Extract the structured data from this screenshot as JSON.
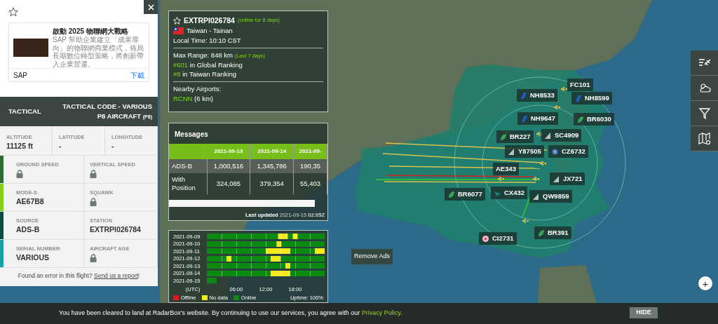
{
  "flight_panel": {
    "ad": {
      "title": "啟動 2025 物聯網大戰略",
      "body": "SAP 幫助企業建立「成果導向」的物聯網商業模式，佈局長期數位轉型策略，將創新帶入企業營運。",
      "advertiser": "SAP",
      "cta": "下載"
    },
    "header": {
      "label": "TACTICAL",
      "title": "TACTICAL CODE - VARIOUS P8 AIRCRAFT",
      "code": "(P8)"
    },
    "position": [
      {
        "label": "ALTITUDE",
        "value": "11125 ft"
      },
      {
        "label": "LATITUDE",
        "value": "-"
      },
      {
        "label": "LONGITUDE",
        "value": "-"
      }
    ],
    "details": [
      {
        "color": "#2e6b36",
        "fields": [
          {
            "label": "GROUND SPEED",
            "locked": true
          },
          {
            "label": "VERTICAL SPEED",
            "locked": true
          }
        ]
      },
      {
        "color": "#86d01a",
        "fields": [
          {
            "label": "MODE-S",
            "value": "AE67B8",
            "locked": false
          },
          {
            "label": "SQUAWK",
            "locked": true
          }
        ]
      },
      {
        "color": "#0d4a44",
        "fields": [
          {
            "label": "SOURCE",
            "value": "ADS-B",
            "locked": false
          },
          {
            "label": "STATION",
            "value": "EXTRPI026784",
            "locked": false
          }
        ]
      },
      {
        "color": "#19a1a6",
        "fields": [
          {
            "label": "SERIAL NUMBER",
            "value": "VARIOUS",
            "locked": false
          },
          {
            "label": "AIRCRAFT AGE",
            "locked": true
          }
        ]
      }
    ],
    "report": {
      "text": "Found an error in this flight?",
      "link": "Send us a report",
      "end": "!"
    }
  },
  "station": {
    "id": "EXTRPI026784",
    "online": "(online for 8 days)",
    "location": "Taiwan - Tainan",
    "local_time": "Local Time: 10:10 CST",
    "max_range": "Max Range: 848 km",
    "range_period": "(Last 7 days)",
    "rankings": [
      {
        "rank": "#601",
        "text": "in Global Ranking"
      },
      {
        "rank": "#8",
        "text": "in Taiwan Ranking"
      }
    ],
    "nearby_title": "Nearby Airports:",
    "airports": [
      {
        "code": "RCNN",
        "distance": "(6 km)"
      }
    ]
  },
  "messages": {
    "title": "Messages",
    "columns": [
      "2021-09-13",
      "2021-09-14",
      "2021-09-"
    ],
    "rows": [
      {
        "label": "ADS-B",
        "cells": [
          "1,000,516",
          "1,345,786",
          "190,35"
        ]
      },
      {
        "label": "With Position",
        "cells": [
          "324,085",
          "379,354",
          "55,403"
        ]
      }
    ],
    "updated_label": "Last updated",
    "updated": "2021-09-15 **02:05Z**"
  },
  "uptime": {
    "dates": [
      "2021-09-09",
      "2021-09-10",
      "2021-09-11",
      "2021-09-12",
      "2021-09-13",
      "2021-09-14",
      "2021-09-15"
    ],
    "ticks": [
      "(UTC)",
      "06:00",
      "12:00",
      "18:00"
    ],
    "legend": [
      {
        "label": "Offline",
        "color": "#e8141b"
      },
      {
        "label": "No data",
        "color": "#f4ea1c"
      },
      {
        "label": "Online",
        "color": "#0b8a12"
      }
    ],
    "uptime": "Uptime: 100%"
  },
  "map": {
    "flights": [
      {
        "callsign": "FC101",
        "kind": "none"
      },
      {
        "callsign": "NH8533",
        "kind": "slash"
      },
      {
        "callsign": "NH8599",
        "kind": "slash"
      },
      {
        "callsign": "NH9647",
        "kind": "slash"
      },
      {
        "callsign": "BR6030",
        "kind": "leaf"
      },
      {
        "callsign": "BR227",
        "kind": "leaf"
      },
      {
        "callsign": "SC4909",
        "kind": "fin"
      },
      {
        "callsign": "Y87505",
        "kind": "fin"
      },
      {
        "callsign": "CZ6732",
        "kind": "bloom"
      },
      {
        "callsign": "AE343",
        "kind": "none"
      },
      {
        "callsign": "JX721",
        "kind": "fin"
      },
      {
        "callsign": "BR6077",
        "kind": "leaf"
      },
      {
        "callsign": "CX432",
        "kind": "swoosh"
      },
      {
        "callsign": "QW9859",
        "kind": "fin"
      },
      {
        "callsign": "BR391",
        "kind": "leaf"
      },
      {
        "callsign": "CI2731",
        "kind": "flower"
      }
    ],
    "remove_ads": "Remove Ads",
    "zoom_in": "+"
  },
  "cookie": {
    "text": "You have been cleared to land at RadarBox's website. By continuing to use our services, you agree with our",
    "link": "Privacy Policy",
    "end": ".",
    "button": "HIDE"
  }
}
